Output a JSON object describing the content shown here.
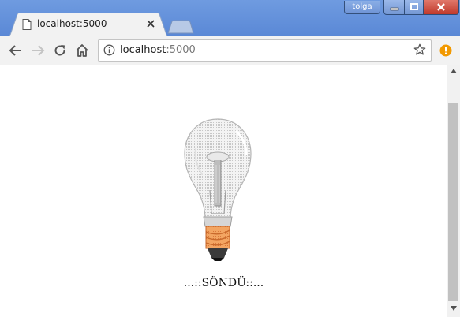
{
  "window": {
    "user_label": "tolga",
    "accent_color": "#5a88d6"
  },
  "tab": {
    "title": "localhost:5000",
    "favicon": "page-icon"
  },
  "toolbar": {
    "back": "back-arrow-icon",
    "forward": "forward-arrow-icon",
    "reload": "reload-icon",
    "home": "home-icon"
  },
  "address_bar": {
    "host": "localhost",
    "port": ":5000",
    "bookmark": "star-icon",
    "extension": "warning-icon"
  },
  "page": {
    "image": "light-bulb (off)",
    "status_text": "...::SÖNDÜ::..."
  }
}
